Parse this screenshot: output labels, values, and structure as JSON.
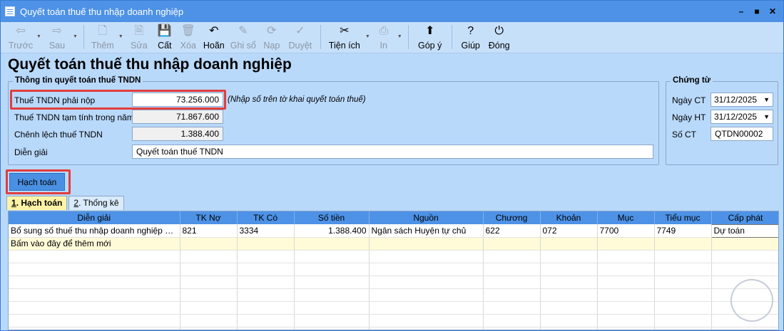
{
  "window": {
    "title": "Quyết toán thuế thu nhập doanh nghiệp",
    "controls": [
      "–",
      "■",
      "✕"
    ]
  },
  "toolbar": {
    "items": [
      {
        "label": "Trước",
        "icon": "arrow-left-icon",
        "glyph": "⇦",
        "enabled": false,
        "caret": true
      },
      {
        "label": "Sau",
        "icon": "arrow-right-icon",
        "glyph": "⇨",
        "enabled": false,
        "caret": true
      },
      {
        "label": "Thêm",
        "icon": "new-document-icon",
        "glyph": "🗋",
        "enabled": false,
        "caret": true
      },
      {
        "label": "Sửa",
        "icon": "edit-document-icon",
        "glyph": "🗎",
        "enabled": false
      },
      {
        "label": "Cất",
        "icon": "save-icon",
        "glyph": "💾",
        "enabled": true
      },
      {
        "label": "Xóa",
        "icon": "delete-document-icon",
        "glyph": "🗑",
        "enabled": false
      },
      {
        "label": "Hoãn",
        "icon": "undo-icon",
        "glyph": "↶",
        "enabled": true
      },
      {
        "label": "Ghi sổ",
        "icon": "pencil-icon",
        "glyph": "✎",
        "enabled": false
      },
      {
        "label": "Nạp",
        "icon": "refresh-icon",
        "glyph": "⟳",
        "enabled": false
      },
      {
        "label": "Duyệt",
        "icon": "checkmark-icon",
        "glyph": "✓",
        "enabled": false
      },
      {
        "label": "Tiện ích",
        "icon": "tools-icon",
        "glyph": "✂",
        "enabled": true,
        "caret": true
      },
      {
        "label": "In",
        "icon": "printer-icon",
        "glyph": "⎙",
        "enabled": false,
        "caret": true
      },
      {
        "label": "Góp ý",
        "icon": "feedback-icon",
        "glyph": "⬆",
        "enabled": true
      },
      {
        "label": "Giúp",
        "icon": "help-icon",
        "glyph": "?",
        "enabled": true
      },
      {
        "label": "Đóng",
        "icon": "power-icon",
        "glyph": "⏻",
        "enabled": true
      }
    ]
  },
  "page": {
    "title": "Quyết toán thuế thu nhập doanh nghiệp"
  },
  "info_group": {
    "title": "Thông tin quyết toán thuế TNDN",
    "fields": {
      "payable_label": "Thuế TNDN phải nộp",
      "payable_value": "73.256.000",
      "note": "(Nhập số trên tờ khai quyết toán thuế)",
      "provisional_label": "Thuế TNDN tạm tính trong năm",
      "provisional_value": "71.867.600",
      "diff_label": "Chênh lệch thuế TNDN",
      "diff_value": "1.388.400",
      "desc_label": "Diễn giải",
      "desc_value": "Quyết toán thuế TNDN"
    }
  },
  "voucher_group": {
    "title": "Chứng từ",
    "ngay_ct_label": "Ngày CT",
    "ngay_ct_value": "31/12/2025",
    "ngay_ht_label": "Ngày HT",
    "ngay_ht_value": "31/12/2025",
    "so_ct_label": "Số CT",
    "so_ct_value": "QTDN00002"
  },
  "actions": {
    "hach_toan_label": "Hạch toán"
  },
  "tabs": [
    {
      "key": "1",
      "label": ". Hạch toán",
      "active": true
    },
    {
      "key": "2",
      "label": ". Thống kê",
      "active": false
    }
  ],
  "grid": {
    "columns": [
      "Diễn giải",
      "TK Nợ",
      "TK Có",
      "Số tiền",
      "Nguồn",
      "Chương",
      "Khoản",
      "Mục",
      "Tiểu mục",
      "Cấp phát"
    ],
    "rows": [
      [
        "Bổ sung số thuế thu nhập doanh nghiệp hiện...",
        "821",
        "3334",
        "1.388.400",
        "Ngân sách Huyện tự chủ",
        "622",
        "072",
        "7700",
        "7749",
        "Dự toán"
      ]
    ],
    "new_row_text": "Bấm vào đây để thêm mới",
    "empty_rows": 7
  },
  "colors": {
    "titlebar": "#4d92e6",
    "background": "#b9d9fb",
    "highlight": "#e23d3d",
    "grid_header": "#4d92e6",
    "active_tab": "#fdf3a7"
  }
}
